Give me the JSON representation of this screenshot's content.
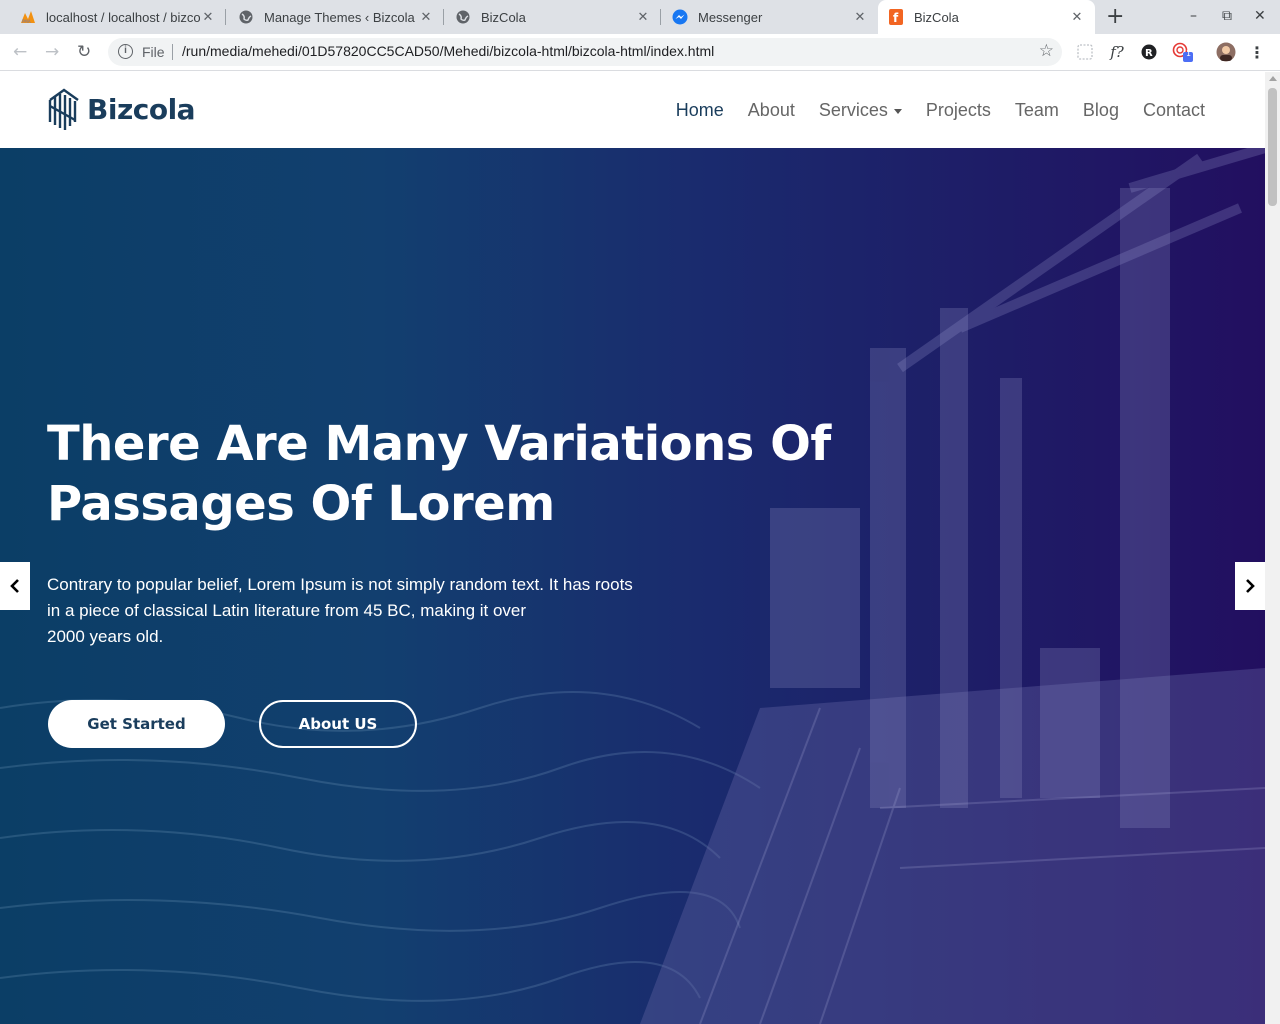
{
  "browser": {
    "tabs": [
      {
        "title": "localhost / localhost / bizcol",
        "icon": "phpmyadmin-icon"
      },
      {
        "title": "Manage Themes ‹ Bizcola –",
        "icon": "globe-icon"
      },
      {
        "title": "BizCola",
        "icon": "globe-icon"
      },
      {
        "title": "Messenger",
        "icon": "messenger-icon"
      },
      {
        "title": "BizCola",
        "icon": "html5-icon",
        "active": true
      }
    ],
    "new_tab": "+",
    "address": {
      "scheme_label": "File",
      "url": "/run/media/mehedi/01D57820CC5CAD50/Mehedi/bizcola-html/bizcola-html/index.html"
    },
    "extension_badge": "1"
  },
  "site": {
    "logo_text": "Bizcola",
    "nav": [
      {
        "label": "Home",
        "active": true
      },
      {
        "label": "About"
      },
      {
        "label": "Services",
        "dropdown": true
      },
      {
        "label": "Projects"
      },
      {
        "label": "Team"
      },
      {
        "label": "Blog"
      },
      {
        "label": "Contact"
      }
    ]
  },
  "hero": {
    "title_line1": "There Are Many Variations Of",
    "title_line2": "Passages Of Lorem",
    "text_line1": "Contrary to popular belief, Lorem Ipsum is not simply random text. It has roots",
    "text_line2": "in a piece of classical Latin literature from 45 BC, making it over",
    "text_line3": "2000 years old.",
    "primary_button": "Get Started",
    "secondary_button": "About US",
    "prev_arrow": "‹",
    "next_arrow": "›"
  },
  "colors": {
    "brand": "#1a3d5c",
    "hero_start": "#0b3e66",
    "hero_end": "#220f60",
    "tab_bar": "#dee1e6"
  }
}
